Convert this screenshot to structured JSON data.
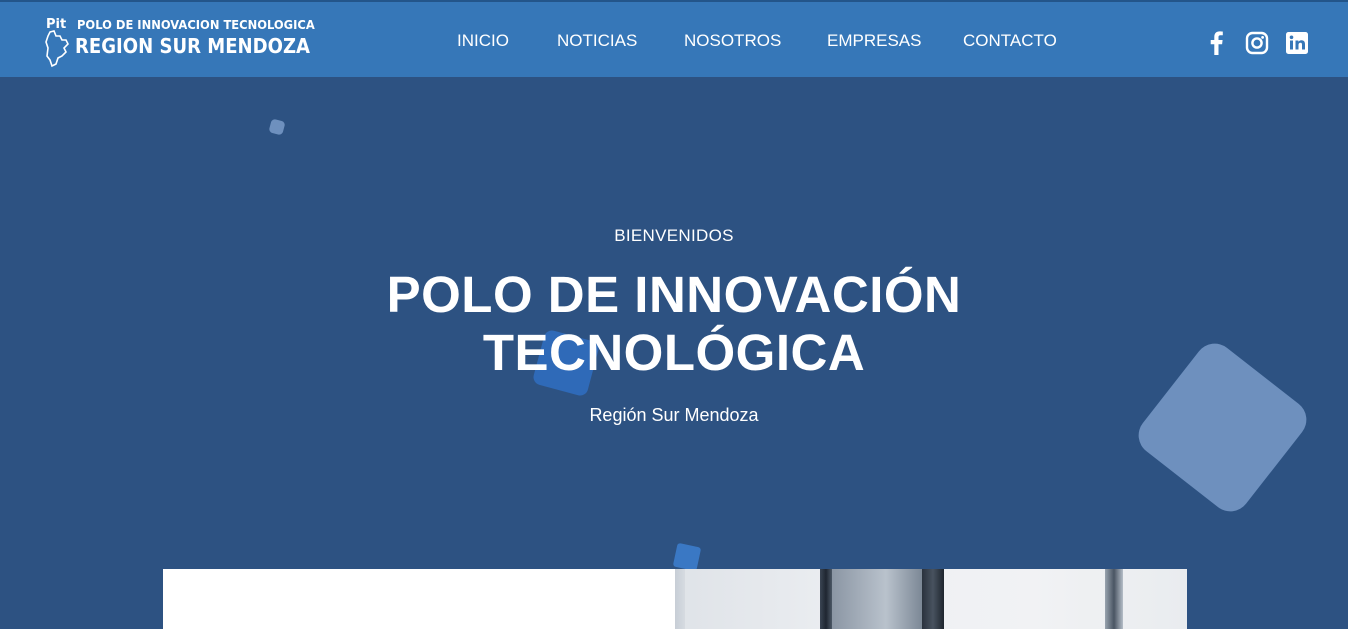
{
  "logo": {
    "line1": "POLO DE INNOVACION TECNOLOGICA",
    "line2": "REGION SUR MENDOZA"
  },
  "nav": {
    "items": [
      "INICIO",
      "NOTICIAS",
      "NOSOTROS",
      "EMPRESAS",
      "CONTACTO"
    ]
  },
  "social": {
    "icons": [
      "facebook-icon",
      "instagram-icon",
      "linkedin-icon"
    ]
  },
  "hero": {
    "eyebrow": "BIENVENIDOS",
    "title_line1": "POLO DE INNOVACIÓN",
    "title_line2": "TECNOLÓGICA",
    "subtitle": "Región Sur Mendoza"
  },
  "colors": {
    "header": "#3677b8",
    "hero_bg": "#2d5282",
    "accent_light": "#6e90be",
    "accent_blue": "#2f6ab8"
  }
}
